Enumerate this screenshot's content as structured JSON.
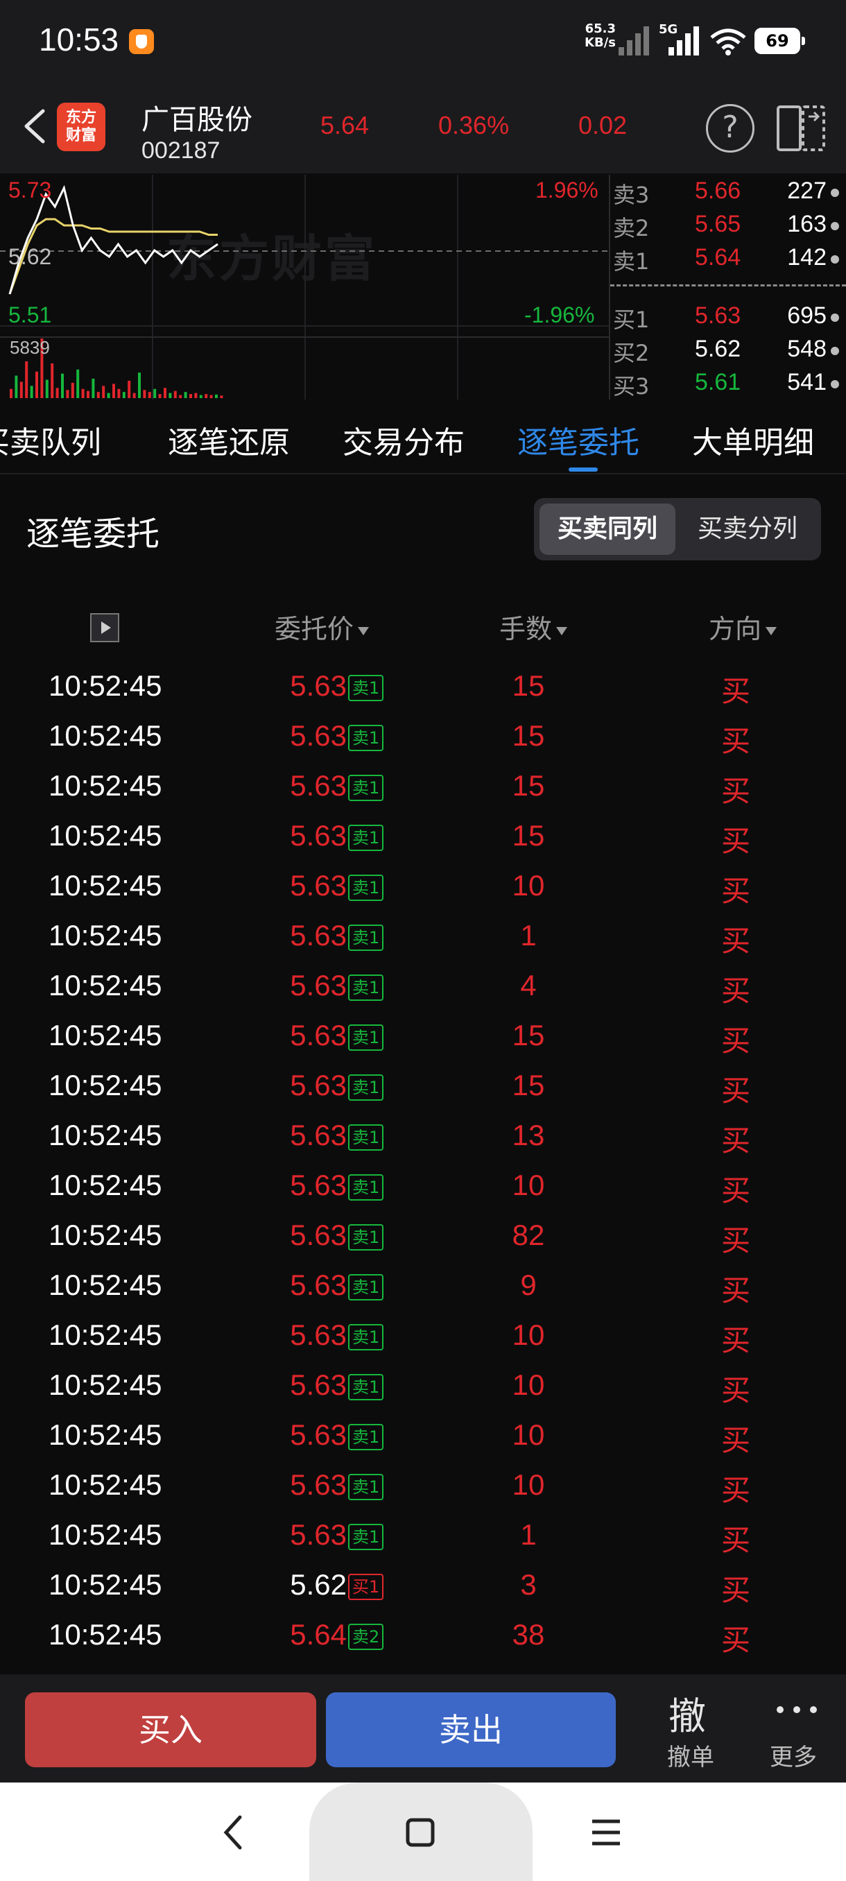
{
  "status_bar": {
    "time": "10:53",
    "net_speed_value": "65.3",
    "net_speed_unit": "KB/s",
    "network": "5G",
    "battery": "69"
  },
  "header": {
    "logo_line1": "东方",
    "logo_line2": "财富",
    "stock_name": "广百股份",
    "stock_code": "002187",
    "price": "5.64",
    "change_pct": "0.36%",
    "change": "0.02"
  },
  "chart": {
    "high_label": "5.73",
    "mid_label": "5.62",
    "low_label": "5.51",
    "high_pct": "1.96%",
    "low_pct": "-1.96%",
    "volume_label": "5839",
    "watermark": "东方财富"
  },
  "chart_data": {
    "type": "line",
    "title": "",
    "xlabel": "",
    "ylabel": "",
    "ylim": [
      5.51,
      5.73
    ],
    "series": [
      {
        "values": [
          5.55,
          5.6,
          5.64,
          5.67,
          5.71,
          5.69,
          5.72,
          5.66,
          5.62,
          5.64,
          5.62,
          5.61,
          5.63,
          5.61,
          5.62,
          5.6,
          5.62,
          5.61,
          5.62,
          5.6,
          5.62,
          5.61,
          5.62,
          5.63
        ]
      },
      {
        "values": [
          5.55,
          5.59,
          5.63,
          5.66,
          5.67,
          5.67,
          5.66,
          5.66,
          5.66,
          5.655,
          5.655,
          5.65,
          5.65,
          5.65,
          5.65,
          5.65,
          5.65,
          5.65,
          5.65,
          5.65,
          5.65,
          5.65,
          5.645,
          5.645
        ]
      }
    ],
    "volume": {
      "max": 5839,
      "values": [
        900,
        2200,
        1600,
        3600,
        1200,
        2600,
        5839,
        1800,
        3400,
        1000,
        2400,
        800,
        1500,
        2800,
        900,
        700,
        1900,
        600,
        1200,
        500,
        1400,
        900,
        600,
        1700,
        500,
        2500,
        800,
        600,
        900,
        400,
        1000,
        500,
        700,
        300,
        600,
        400,
        500,
        300,
        400,
        300,
        350,
        250
      ]
    }
  },
  "orderbook": {
    "asks": [
      {
        "label": "卖3",
        "price": "5.66",
        "volume": "227"
      },
      {
        "label": "卖2",
        "price": "5.65",
        "volume": "163"
      },
      {
        "label": "卖1",
        "price": "5.64",
        "volume": "142"
      }
    ],
    "bids": [
      {
        "label": "买1",
        "price": "5.63",
        "volume": "695"
      },
      {
        "label": "买2",
        "price": "5.62",
        "volume": "548"
      },
      {
        "label": "买3",
        "price": "5.61",
        "volume": "541"
      }
    ]
  },
  "tabs": [
    {
      "label": "买卖队列"
    },
    {
      "label": "逐笔还原"
    },
    {
      "label": "交易分布"
    },
    {
      "label": "逐笔委托"
    },
    {
      "label": "大单明细"
    }
  ],
  "section": {
    "title": "逐笔委托",
    "toggle_on": "买卖同列",
    "toggle_off": "买卖分列"
  },
  "columns": {
    "price": "委托价",
    "qty": "手数",
    "direction": "方向"
  },
  "rows": [
    {
      "time": "10:52:45",
      "price": "5.63",
      "badge": "卖1",
      "qty": "15",
      "dir": "买"
    },
    {
      "time": "10:52:45",
      "price": "5.63",
      "badge": "卖1",
      "qty": "15",
      "dir": "买"
    },
    {
      "time": "10:52:45",
      "price": "5.63",
      "badge": "卖1",
      "qty": "15",
      "dir": "买"
    },
    {
      "time": "10:52:45",
      "price": "5.63",
      "badge": "卖1",
      "qty": "15",
      "dir": "买"
    },
    {
      "time": "10:52:45",
      "price": "5.63",
      "badge": "卖1",
      "qty": "10",
      "dir": "买"
    },
    {
      "time": "10:52:45",
      "price": "5.63",
      "badge": "卖1",
      "qty": "1",
      "dir": "买"
    },
    {
      "time": "10:52:45",
      "price": "5.63",
      "badge": "卖1",
      "qty": "4",
      "dir": "买"
    },
    {
      "time": "10:52:45",
      "price": "5.63",
      "badge": "卖1",
      "qty": "15",
      "dir": "买"
    },
    {
      "time": "10:52:45",
      "price": "5.63",
      "badge": "卖1",
      "qty": "15",
      "dir": "买"
    },
    {
      "time": "10:52:45",
      "price": "5.63",
      "badge": "卖1",
      "qty": "13",
      "dir": "买"
    },
    {
      "time": "10:52:45",
      "price": "5.63",
      "badge": "卖1",
      "qty": "10",
      "dir": "买"
    },
    {
      "time": "10:52:45",
      "price": "5.63",
      "badge": "卖1",
      "qty": "82",
      "dir": "买"
    },
    {
      "time": "10:52:45",
      "price": "5.63",
      "badge": "卖1",
      "qty": "9",
      "dir": "买"
    },
    {
      "time": "10:52:45",
      "price": "5.63",
      "badge": "卖1",
      "qty": "10",
      "dir": "买"
    },
    {
      "time": "10:52:45",
      "price": "5.63",
      "badge": "卖1",
      "qty": "10",
      "dir": "买"
    },
    {
      "time": "10:52:45",
      "price": "5.63",
      "badge": "卖1",
      "qty": "10",
      "dir": "买"
    },
    {
      "time": "10:52:45",
      "price": "5.63",
      "badge": "卖1",
      "qty": "10",
      "dir": "买"
    },
    {
      "time": "10:52:45",
      "price": "5.63",
      "badge": "卖1",
      "qty": "1",
      "dir": "买"
    },
    {
      "time": "10:52:45",
      "price": "5.62",
      "badge": "买1",
      "qty": "3",
      "dir": "买"
    },
    {
      "time": "10:52:45",
      "price": "5.64",
      "badge": "卖2",
      "qty": "38",
      "dir": "买"
    }
  ],
  "bottom": {
    "buy": "买入",
    "sell": "卖出",
    "cancel_glyph": "撤",
    "cancel_label": "撤单",
    "more_label": "更多"
  },
  "colors": {
    "up": "#e0262b",
    "down": "#16b73c",
    "active_tab": "#2f88e8",
    "price_line": "#ffffff",
    "avg_line": "#e8d36a"
  }
}
